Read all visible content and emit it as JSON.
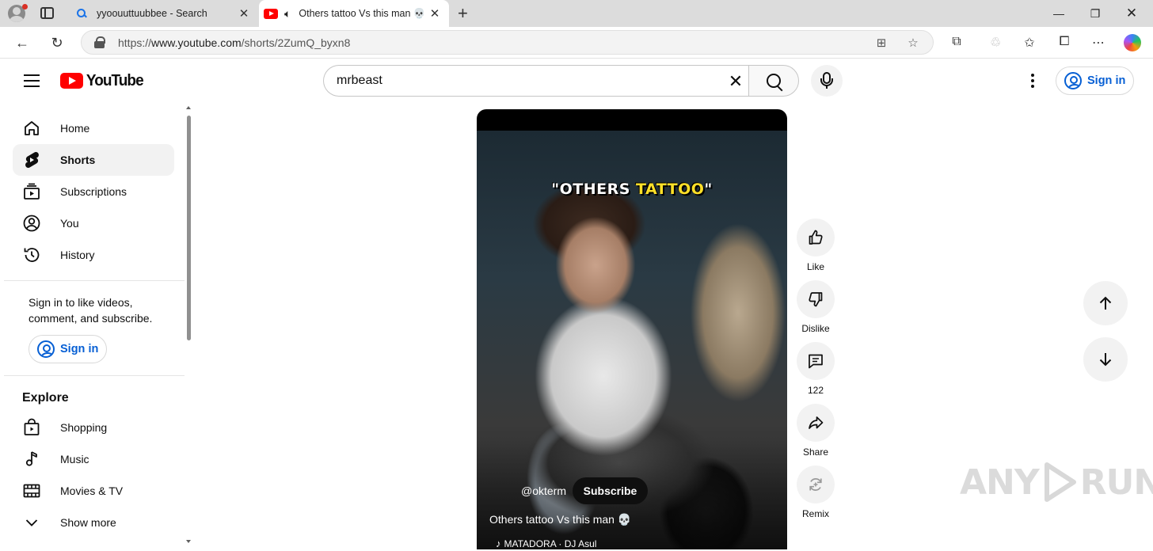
{
  "browser": {
    "tabs": [
      {
        "title": "yyoouuttuubbee - Search"
      },
      {
        "title": "Others tattoo Vs this man 💀"
      }
    ],
    "url_prefix": "https://",
    "url_host": "www.youtube.com",
    "url_path": "/shorts/2ZumQ_byxn8"
  },
  "header": {
    "logo_text": "YouTube",
    "search_value": "mrbeast",
    "signin_label": "Sign in"
  },
  "sidebar": {
    "items": [
      {
        "label": "Home",
        "icon": "home-icon"
      },
      {
        "label": "Shorts",
        "icon": "shorts-icon"
      },
      {
        "label": "Subscriptions",
        "icon": "subscriptions-icon"
      },
      {
        "label": "You",
        "icon": "you-icon"
      },
      {
        "label": "History",
        "icon": "history-icon"
      }
    ],
    "signin_prompt": "Sign in to like videos, comment, and subscribe.",
    "signin_label": "Sign in",
    "explore_title": "Explore",
    "explore_items": [
      {
        "label": "Shopping",
        "icon": "shopping-icon"
      },
      {
        "label": "Music",
        "icon": "music-icon"
      },
      {
        "label": "Movies & TV",
        "icon": "movies-icon"
      },
      {
        "label": "Show more",
        "icon": "chevron-down-icon"
      }
    ]
  },
  "short": {
    "caption_part1": "\"OTHERS ",
    "caption_part2": "TATTOO",
    "caption_part3": "\"",
    "channel": "@okterm",
    "subscribe_label": "Subscribe",
    "title": "Others tattoo Vs this man 💀",
    "music": "MATADORA · DJ Asul"
  },
  "actions": {
    "like": "Like",
    "dislike": "Dislike",
    "comments": "122",
    "share": "Share",
    "remix": "Remix"
  },
  "watermark": {
    "left": "ANY",
    "right": "RUN"
  },
  "colors": {
    "brand_red": "#ff0000",
    "link_blue": "#065fd4",
    "caption_yellow": "#ffe028"
  }
}
